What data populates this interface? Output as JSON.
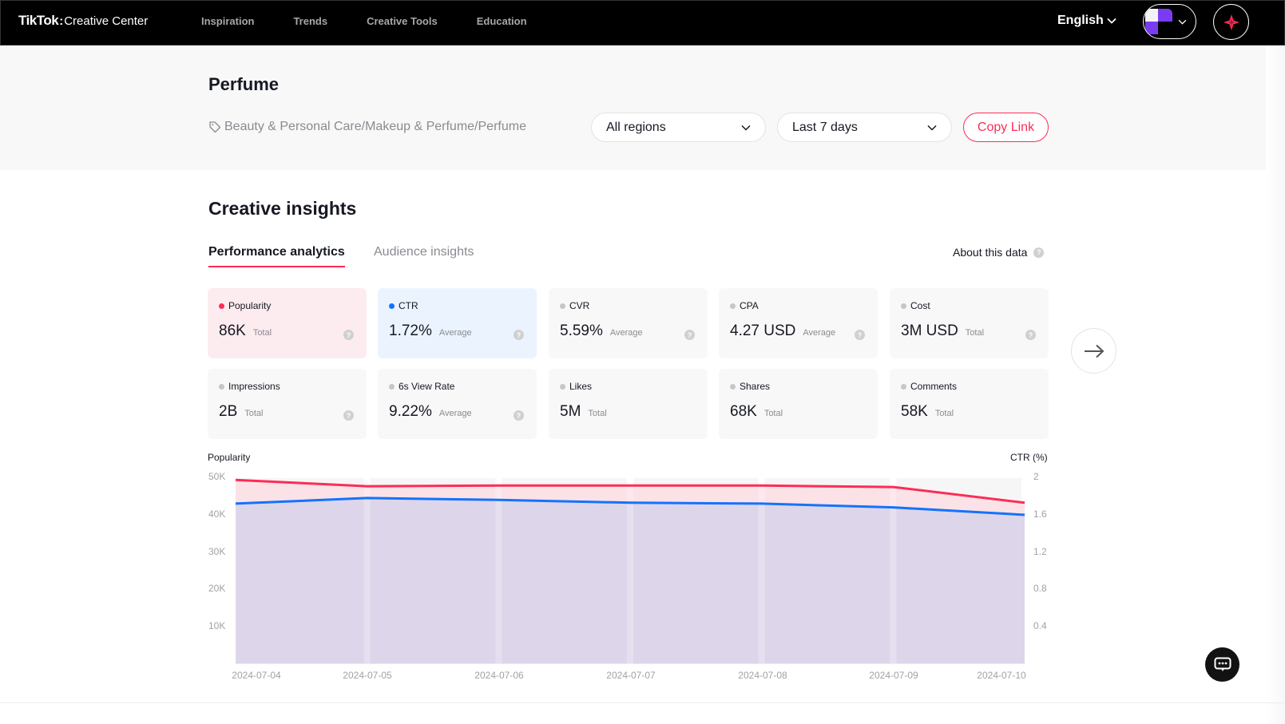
{
  "header": {
    "logo_brand": "TikTok",
    "logo_product": "Creative Center",
    "nav": [
      "Inspiration",
      "Trends",
      "Creative Tools",
      "Education"
    ],
    "language": "English"
  },
  "hero": {
    "title": "Perfume",
    "category": "Beauty & Personal Care/Makeup & Perfume/Perfume",
    "region_select": "All regions",
    "period_select": "Last 7 days",
    "copy_link": "Copy Link"
  },
  "insights": {
    "title": "Creative insights",
    "tabs": [
      "Performance analytics",
      "Audience insights"
    ],
    "active_tab": "Performance analytics",
    "about": "About this data"
  },
  "metrics": [
    {
      "label": "Popularity",
      "value": "86K",
      "unit": "Total",
      "color": "#fe2c55",
      "help": true
    },
    {
      "label": "CTR",
      "value": "1.72%",
      "unit": "Average",
      "color": "#1472ff",
      "help": true
    },
    {
      "label": "CVR",
      "value": "5.59%",
      "unit": "Average",
      "color": "#c6c6c8",
      "help": true
    },
    {
      "label": "CPA",
      "value": "4.27 USD",
      "unit": "Average",
      "color": "#c6c6c8",
      "help": true
    },
    {
      "label": "Cost",
      "value": "3M USD",
      "unit": "Total",
      "color": "#c6c6c8",
      "help": true
    },
    {
      "label": "Impressions",
      "value": "2B",
      "unit": "Total",
      "color": "#c6c6c8",
      "help": true
    },
    {
      "label": "6s View Rate",
      "value": "9.22%",
      "unit": "Average",
      "color": "#c6c6c8",
      "help": true
    },
    {
      "label": "Likes",
      "value": "5M",
      "unit": "Total",
      "color": "#c6c6c8",
      "help": false
    },
    {
      "label": "Shares",
      "value": "68K",
      "unit": "Total",
      "color": "#c6c6c8",
      "help": false
    },
    {
      "label": "Comments",
      "value": "58K",
      "unit": "Total",
      "color": "#c6c6c8",
      "help": false
    }
  ],
  "chart_data": {
    "type": "area",
    "title": "",
    "x": [
      "2024-07-04",
      "2024-07-05",
      "2024-07-06",
      "2024-07-07",
      "2024-07-08",
      "2024-07-09",
      "2024-07-10"
    ],
    "ylabel_left": "Popularity",
    "ylabel_right": "CTR (%)",
    "y_left_ticks": [
      "50K",
      "40K",
      "30K",
      "20K",
      "10K"
    ],
    "y_right_ticks": [
      "2",
      "1.6",
      "1.2",
      "0.8",
      "0.4"
    ],
    "y_left_range": [
      0,
      50000
    ],
    "y_right_range": [
      0,
      2
    ],
    "grid": false,
    "legend": "none",
    "series": [
      {
        "name": "Popularity",
        "axis": "left",
        "color": "#fe2c55",
        "fill": "#fbe2e7",
        "values": [
          49100,
          47400,
          47600,
          47600,
          47600,
          47200,
          43000
        ]
      },
      {
        "name": "CTR",
        "axis": "right",
        "color": "#1472ff",
        "fill": "#ddd6ea",
        "values": [
          1.71,
          1.77,
          1.75,
          1.72,
          1.71,
          1.67,
          1.59
        ]
      }
    ]
  }
}
